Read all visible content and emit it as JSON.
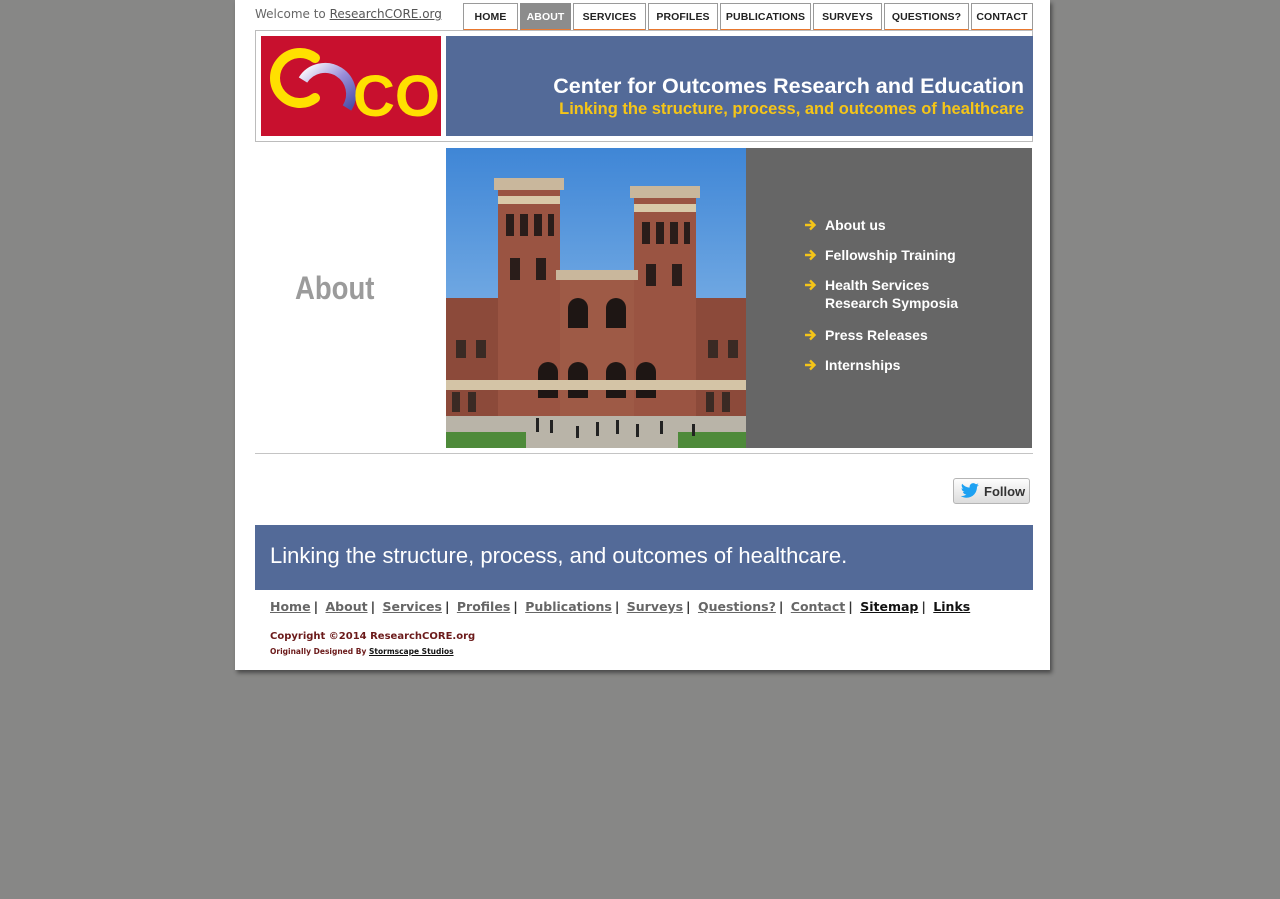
{
  "header": {
    "welcome_prefix": "Welcome to",
    "welcome_link": "ResearchCORE.org"
  },
  "nav": {
    "items": [
      "HOME",
      "ABOUT",
      "SERVICES",
      "PROFILES",
      "PUBLICATIONS",
      "SURVEYS",
      "QUESTIONS?",
      "CONTACT"
    ],
    "active": "ABOUT"
  },
  "banner": {
    "logo_text": "CORE",
    "title": "Center for Outcomes Research and Education",
    "subtitle": "Linking the structure, process, and outcomes of healthcare"
  },
  "section": {
    "title": "About"
  },
  "submenu": {
    "items": [
      "About us",
      "Fellowship Training",
      "Health Services Research Symposia",
      "Press Releases",
      "Internships"
    ]
  },
  "social": {
    "follow_label": "Follow"
  },
  "footer": {
    "tagline": "Linking the structure, process, and outcomes of healthcare.",
    "links": [
      "Home",
      "About",
      "Services",
      "Profiles",
      "Publications",
      "Surveys",
      "Questions?",
      "Contact",
      "Sitemap",
      "Links"
    ],
    "copyright": "Copyright ©2014 ResearchCORE.org",
    "designed_prefix": "Originally Designed By",
    "designed_link": "Stormscape Studios"
  },
  "colors": {
    "background": "#878786",
    "banner_blue": "#536a98",
    "logo_red": "#c8102e",
    "accent_orange": "#e8772e",
    "accent_yellow": "#f5c518",
    "submenu_gray": "#666666"
  }
}
